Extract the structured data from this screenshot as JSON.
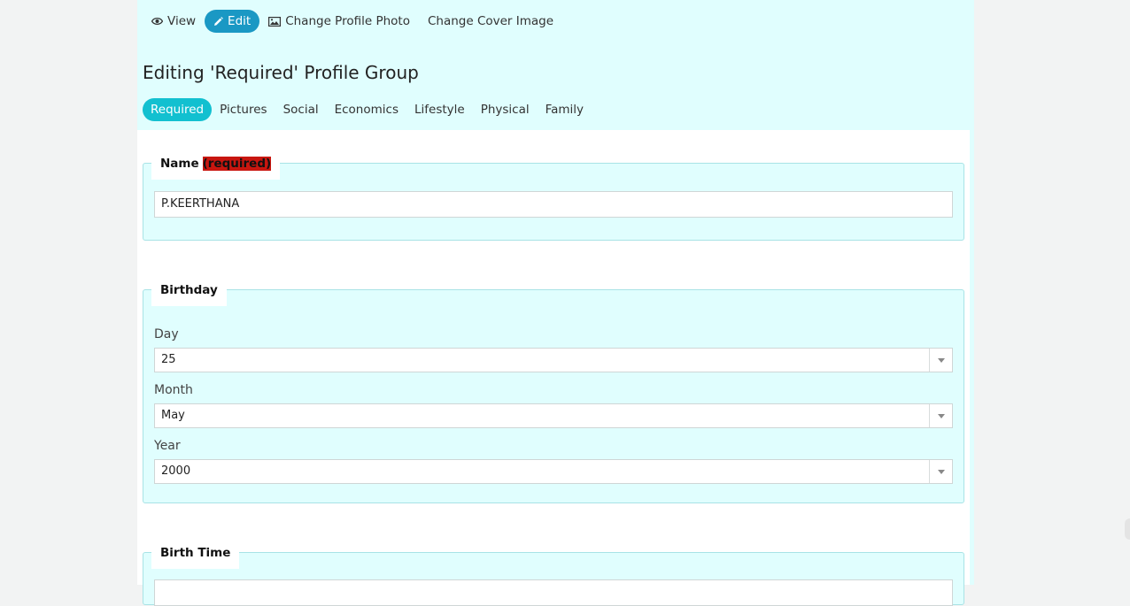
{
  "subnav": {
    "items": [
      {
        "label": "View",
        "icon": "eye-icon"
      },
      {
        "label": "Edit",
        "icon": "pencil-icon",
        "active": true
      },
      {
        "label": "Change Profile Photo",
        "icon": "image-icon"
      },
      {
        "label": "Change Cover Image"
      }
    ]
  },
  "page": {
    "title": "Editing 'Required' Profile Group"
  },
  "group_tabs": [
    "Required",
    "Pictures",
    "Social",
    "Economics",
    "Lifestyle",
    "Physical",
    "Family"
  ],
  "name_field": {
    "legend": "Name",
    "required_tag": "(required)",
    "value": "P.KEERTHANA"
  },
  "birthday": {
    "legend": "Birthday",
    "day": {
      "label": "Day",
      "value": "25"
    },
    "month": {
      "label": "Month",
      "value": "May"
    },
    "year": {
      "label": "Year",
      "value": "2000"
    }
  },
  "birth_time": {
    "legend": "Birth Time"
  },
  "colors": {
    "page_bg": "#e0fefe",
    "edit_active": "#1a98c4",
    "tab_active": "#12c0d0",
    "required_tag": "#c8160f"
  }
}
